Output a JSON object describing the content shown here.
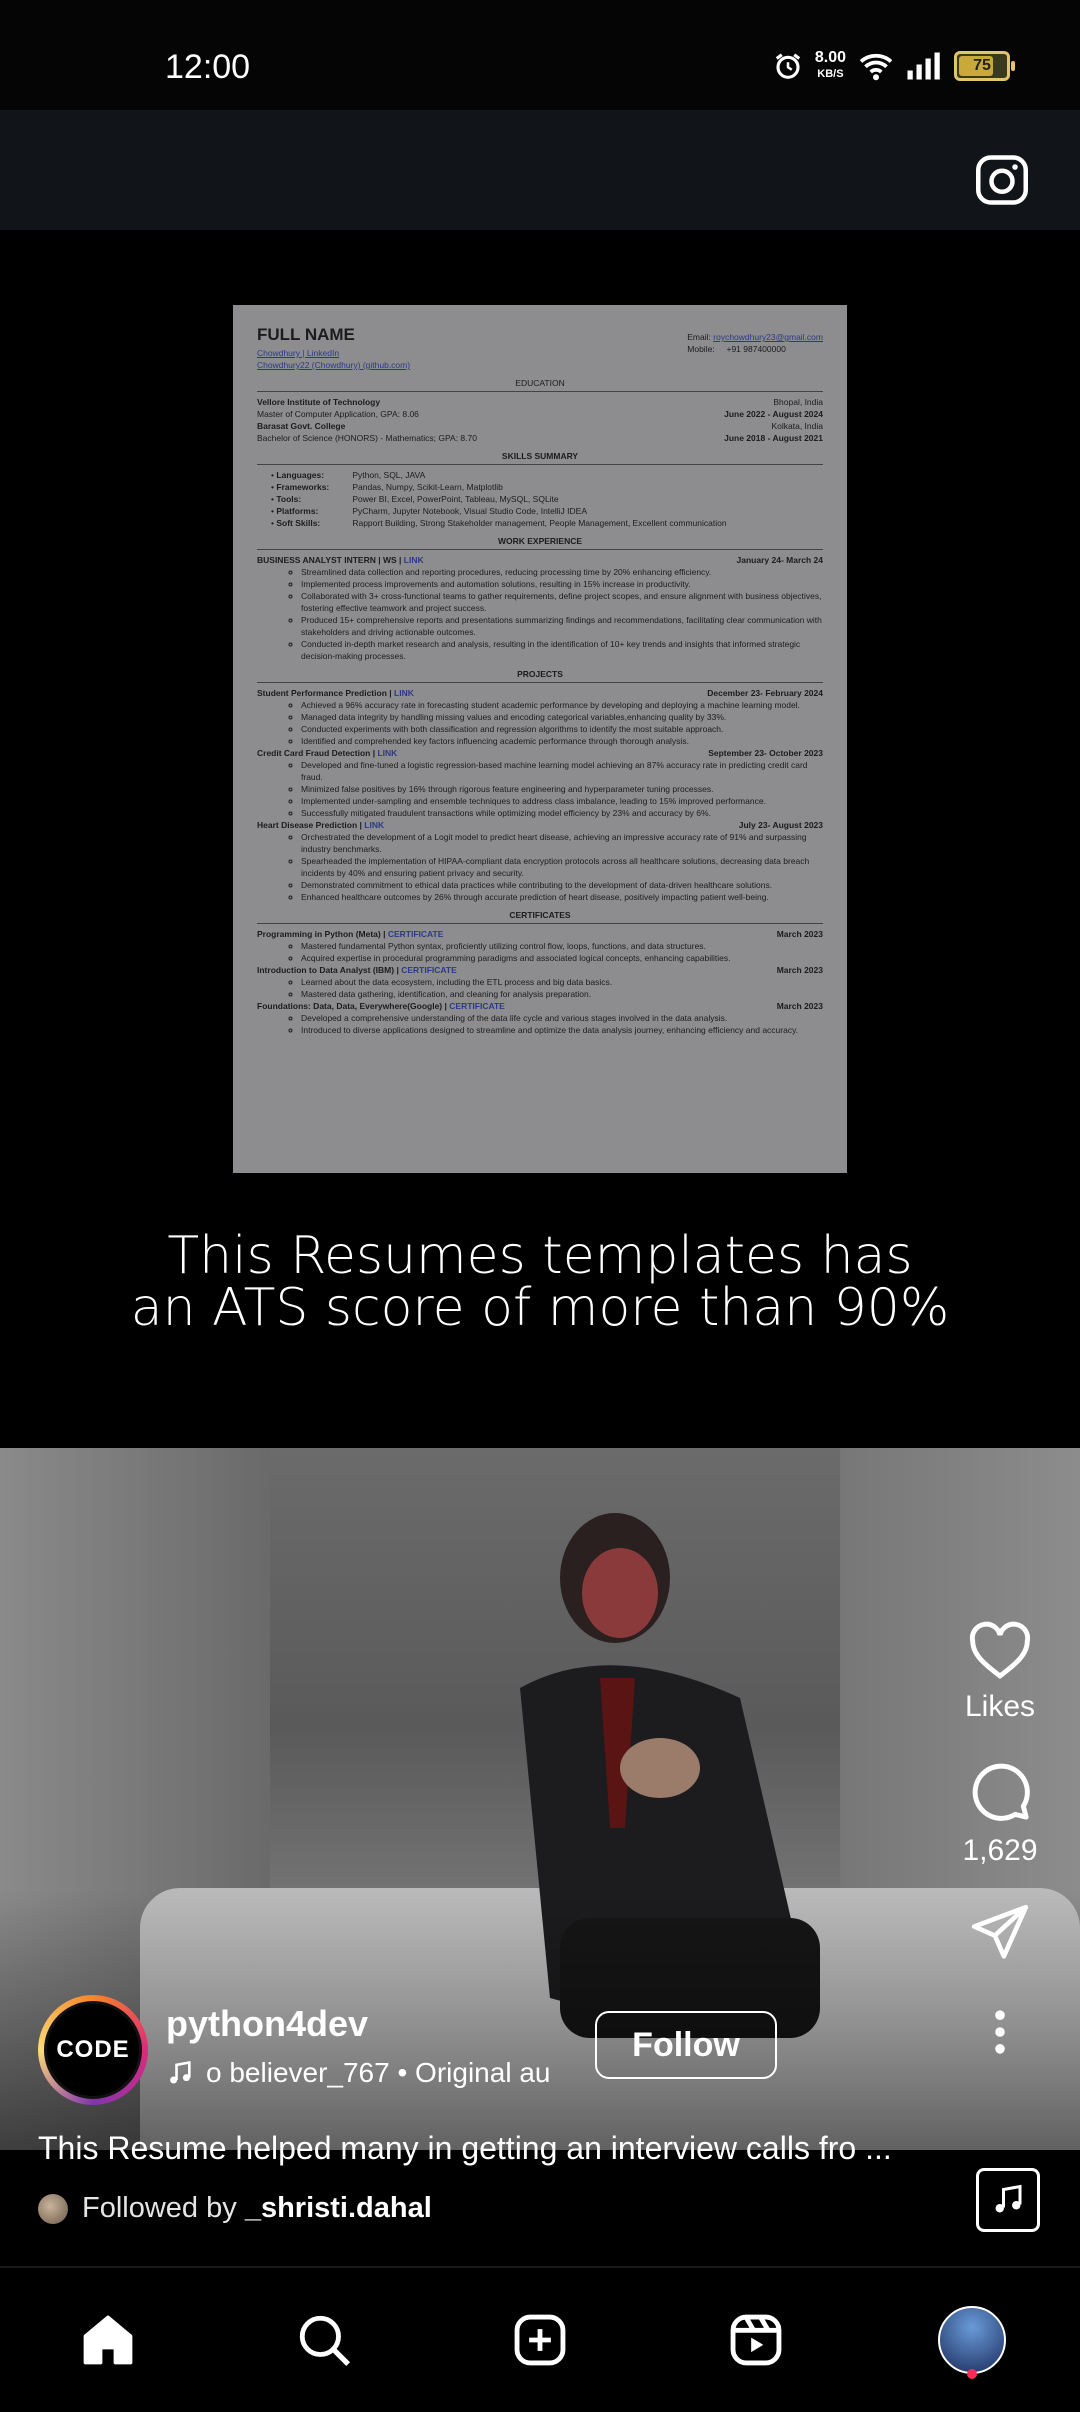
{
  "status_bar": {
    "time": "12:00",
    "speed_value": "8.00",
    "speed_unit": "KB/S",
    "battery": "75"
  },
  "resume": {
    "name": "FULL NAME",
    "link1": "Chowdhury | LinkedIn",
    "link2": "Chowdhury22 (Chowdhury) (github.com)",
    "email_label": "Email:",
    "email": "roychowdhury23@gmail.com",
    "mobile_label": "Mobile:",
    "mobile": "+91 987400000",
    "sec_education": "EDUCATION",
    "edu1_school": "Vellore Institute of Technology",
    "edu1_loc": "Bhopal, India",
    "edu1_degree": "Master of Computer Application, GPA: 8.06",
    "edu1_date": "June 2022 - August 2024",
    "edu2_school": "Barasat Govt. College",
    "edu2_loc": "Kolkata, India",
    "edu2_degree": "Bachelor of Science (HONORS) - Mathematics; GPA: 8.70",
    "edu2_date": "June 2018 - August 2021",
    "sec_skills": "SKILLS SUMMARY",
    "skills": [
      {
        "k": "Languages:",
        "v": "Python, SQL, JAVA"
      },
      {
        "k": "Frameworks:",
        "v": "Pandas, Numpy, Scikit-Learn, Matplotlib"
      },
      {
        "k": "Tools:",
        "v": "Power BI, Excel, PowerPoint, Tableau, MySQL, SQLite"
      },
      {
        "k": "Platforms:",
        "v": "PyCharm, Jupyter Notebook, Visual Studio Code, IntelliJ IDEA"
      },
      {
        "k": "Soft Skills:",
        "v": "Rapport Building, Strong Stakeholder management, People Management, Excellent communication"
      }
    ],
    "sec_work": "WORK EXPERIENCE",
    "work_title": "BUSINESS ANALYST INTERN | WS |",
    "work_link": "LINK",
    "work_date": "January 24- March 24",
    "work_items": [
      "Streamlined data collection and reporting procedures, reducing processing time by 20% enhancing efficiency.",
      "Implemented process improvements and automation solutions, resulting in 15% increase in productivity.",
      "Collaborated with 3+ cross-functional teams to gather requirements, define project scopes, and ensure alignment with business objectives, fostering effective teamwork and project success.",
      "Produced 15+ comprehensive reports and presentations summarizing findings and recommendations, facilitating clear communication with stakeholders and driving actionable outcomes.",
      "Conducted in-depth market research and analysis, resulting in the identification of 10+ key trends and insights that informed strategic decision-making processes."
    ],
    "sec_projects": "PROJECTS",
    "projects": [
      {
        "title": "Student Performance Prediction |",
        "link": "LINK",
        "date": "December 23- February 2024",
        "items": [
          "Achieved a 96% accuracy rate in forecasting student academic performance by developing and deploying a machine learning model.",
          "Managed data integrity by handling missing values and encoding categorical variables,enhancing quality by 33%.",
          "Conducted experiments with both classification and regression algorithms to identify the most suitable approach.",
          "Identified and comprehended key factors influencing academic performance through thorough analysis."
        ]
      },
      {
        "title": "Credit Card Fraud Detection |",
        "link": "LINK",
        "date": "September 23- October 2023",
        "items": [
          "Developed and fine-tuned a logistic regression-based machine learning model achieving an 87% accuracy rate in predicting credit card fraud.",
          "Minimized false positives by 16% through rigorous feature engineering and hyperparameter tuning processes.",
          "Implemented under-sampling and ensemble techniques to address class imbalance, leading to 15% improved performance.",
          "Successfully mitigated fraudulent transactions while optimizing model efficiency by 23% and accuracy by 6%."
        ]
      },
      {
        "title": "Heart Disease Prediction |",
        "link": "LINK",
        "date": "July 23- August 2023",
        "items": [
          "Orchestrated the development of a Logit model to predict heart disease, achieving an impressive accuracy rate of 91% and surpassing industry benchmarks.",
          "Spearheaded the implementation of HIPAA-compliant data encryption protocols across all healthcare solutions, decreasing data breach incidents by 40% and ensuring patient privacy and security.",
          "Demonstrated commitment to ethical data practices while contributing to the development of data-driven healthcare solutions.",
          "Enhanced healthcare outcomes by 26% through accurate prediction of heart disease, positively impacting patient well-being."
        ]
      }
    ],
    "sec_certs": "CERTIFICATES",
    "certs": [
      {
        "title": "Programming in Python (Meta) |",
        "link": "CERTIFICATE",
        "date": "March 2023",
        "items": [
          "Mastered fundamental Python syntax, proficiently utilizing control flow, loops, functions, and data structures.",
          "Acquired expertise in procedural programming paradigms and associated logical concepts, enhancing capabilities."
        ]
      },
      {
        "title": "Introduction to Data Analyst (IBM) |",
        "link": "CERTIFICATE",
        "date": "March 2023",
        "items": [
          "Learned about the data ecosystem, including the ETL process and big data basics.",
          "Mastered data gathering, identification, and cleaning for analysis preparation."
        ]
      },
      {
        "title": "Foundations: Data, Data, Everywhere(Google) |",
        "link": "CERTIFICATE",
        "date": "March 2023",
        "items": [
          "Developed a comprehensive understanding of the data life cycle and various stages involved in the data analysis.",
          "Introduced to diverse applications designed to streamline and optimize the data analysis journey, enhancing efficiency and accuracy."
        ]
      }
    ]
  },
  "caption_line1": "This Resumes templates has",
  "caption_line2": "an ATS score of more than 90%",
  "actions": {
    "likes_label": "Likes",
    "comments_count": "1,629"
  },
  "author": {
    "avatar_text": "CODE",
    "username": "python4dev",
    "music_text": "o    believer_767 • Original au",
    "follow_label": "Follow"
  },
  "description": "This Resume helped many in getting an interview calls fro ...",
  "followed_by": {
    "prefix": "Followed by",
    "name": "_shristi.dahal"
  },
  "colors": {
    "accent_red": "#ff2d55",
    "background": "#000000"
  }
}
